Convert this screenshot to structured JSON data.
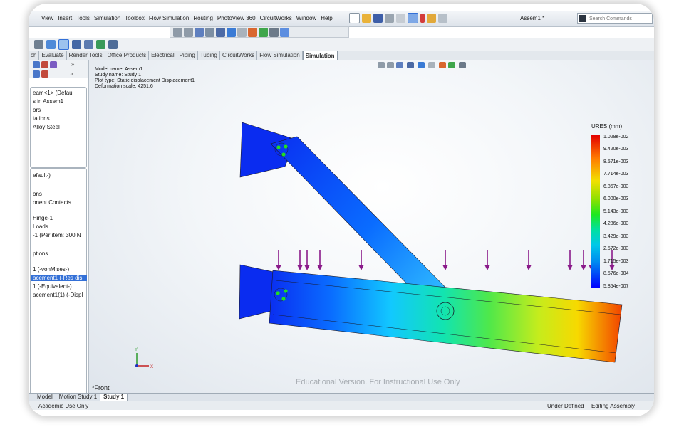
{
  "menu": [
    "View",
    "Insert",
    "Tools",
    "Simulation",
    "Toolbox",
    "Flow Simulation",
    "Routing",
    "PhotoView 360",
    "CircuitWorks",
    "Window",
    "Help"
  ],
  "window": {
    "doc_title": "Assem1 *",
    "search_placeholder": "Search Commands"
  },
  "cmd_tabs": [
    "ch",
    "Evaluate",
    "Render Tools",
    "Office Products",
    "Electrical",
    "Piping",
    "Tubing",
    "CircuitWorks",
    "Flow Simulation",
    "Simulation"
  ],
  "tree": [
    "eam<1> (Defau",
    "s in Assem1",
    "ors",
    "tations",
    "Alloy Steel",
    "efault-)",
    "ons",
    "onent Contacts",
    "Hinge-1",
    "Loads",
    "-1 (Per item: 300 N",
    "ptions",
    "1 (-vonMises-)",
    "acement1 (-Res dis",
    "1 (-Equivalent-)",
    "acement1(1) (-Displ"
  ],
  "info": {
    "model": "Model name: Assem1",
    "study": "Study name: Study 1",
    "plot": "Plot type: Static displacement Displacement1",
    "scale": "Deformation scale: 4251.6"
  },
  "legend": {
    "title": "URES (mm)",
    "values": [
      "1.028e-002",
      "9.420e-003",
      "8.571e-003",
      "7.714e-003",
      "6.857e-003",
      "6.000e-003",
      "5.143e-003",
      "4.286e-003",
      "3.429e-003",
      "2.572e-003",
      "1.715e-003",
      "8.576e-004",
      "5.854e-007"
    ]
  },
  "axes": {
    "y": "Y",
    "x": "X"
  },
  "watermark": "Educational Version. For Instructional Use Only",
  "view_label": "*Front",
  "bottom_tabs": [
    "Model",
    "Motion Study 1",
    "Study 1"
  ],
  "status": {
    "left": "Academic Use Only",
    "state": "Under Defined",
    "mode": "Editing Assembly"
  },
  "colors": {
    "accent": "#3370d7",
    "selection": "#3370d7",
    "arrow": "#8a1a8a",
    "pin": "#22dd22"
  }
}
